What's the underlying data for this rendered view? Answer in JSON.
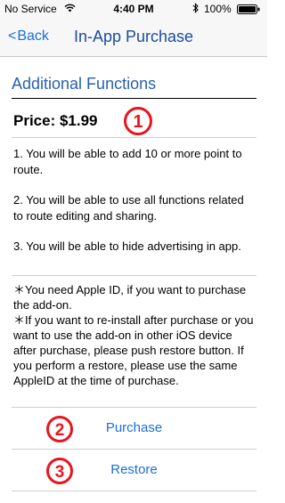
{
  "status_bar": {
    "carrier": "No Service",
    "time": "4:40 PM",
    "battery": "100%"
  },
  "nav": {
    "back_label": "Back",
    "title": "In-App Purchase"
  },
  "section": {
    "title": "Additional Functions"
  },
  "price": {
    "label": "Price: $1.99"
  },
  "markers": [
    "①",
    "②",
    "③"
  ],
  "marker_color": "#e8141e",
  "accent_color": "#1a6fe0",
  "benefits": [
    "1. You will be able to add 10 or more point to route.",
    "2. You will be able to use all functions related to route editing and sharing.",
    "3. You will be able to hide advertising in app."
  ],
  "notes": [
    "＊You need Apple ID, if you want to purchase the add-on.",
    "＊If you want to re-install after purchase or you want to use the add-on in other iOS device  after purchase, please push restore button. If you perform a restore, please use the same AppleID at the time of purchase."
  ],
  "actions": {
    "purchase_label": "Purchase",
    "restore_label": "Restore"
  }
}
